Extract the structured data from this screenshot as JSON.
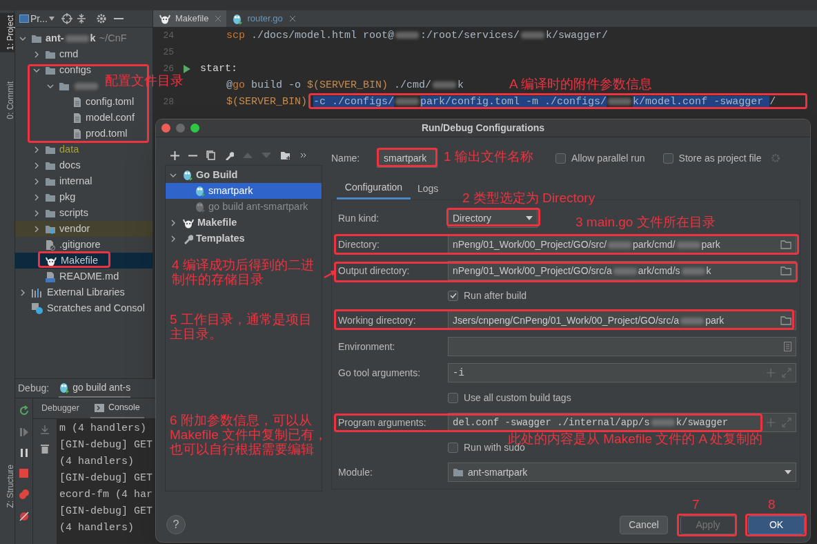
{
  "side_tool_tabs": [
    {
      "label": "1: Project",
      "selected": true
    },
    {
      "label": "0: Commit",
      "selected": false
    },
    {
      "label": "Z: Structure",
      "selected": false
    }
  ],
  "project_panel": {
    "title": "Pr...",
    "tree": [
      {
        "kind": "folder",
        "parts": [
          "ant-",
          "k"
        ],
        "hint": "~/CnF",
        "expanded": true,
        "children": [
          {
            "kind": "folder",
            "label": "cmd",
            "expanded": false
          },
          {
            "kind": "folder",
            "label": "configs",
            "expanded": true,
            "children": [
              {
                "kind": "folder",
                "redacted": true,
                "expanded": true,
                "children": [
                  {
                    "kind": "file",
                    "label": "config.toml"
                  },
                  {
                    "kind": "file",
                    "label": "model.conf"
                  },
                  {
                    "kind": "file",
                    "label": "prod.toml"
                  }
                ]
              }
            ]
          },
          {
            "kind": "folder",
            "label": "data",
            "expanded": false,
            "ignored": true
          },
          {
            "kind": "folder",
            "label": "docs",
            "expanded": false
          },
          {
            "kind": "folder",
            "label": "internal",
            "expanded": false
          },
          {
            "kind": "folder",
            "label": "pkg",
            "expanded": false
          },
          {
            "kind": "folder",
            "label": "scripts",
            "expanded": false
          },
          {
            "kind": "vendor",
            "label": "vendor",
            "expanded": false,
            "highlighted": true
          },
          {
            "kind": "gitignore",
            "label": ".gitignore"
          },
          {
            "kind": "makefile",
            "label": "Makefile",
            "selected": true
          },
          {
            "kind": "markdown",
            "label": "README.md"
          }
        ]
      },
      {
        "kind": "libraries",
        "label": "External Libraries",
        "expanded": false
      },
      {
        "kind": "scratches",
        "label": "Scratches and Consol"
      }
    ]
  },
  "editor": {
    "tabs": [
      {
        "label": "Makefile",
        "kind": "makefile",
        "selected": true
      },
      {
        "label": "router.go",
        "kind": "go",
        "selected": false
      }
    ],
    "lines": [
      {
        "number": "24",
        "tokens": [
          {
            "kind": "keyword",
            "text": "scp"
          },
          {
            "kind": "plain",
            "text": " ./docs/model.html root@"
          },
          {
            "kind": "redacted"
          },
          {
            "kind": "plain",
            "text": ":/root/services/"
          },
          {
            "kind": "redacted"
          },
          {
            "kind": "plain",
            "text": "k/swagger/"
          }
        ]
      },
      {
        "number": "25"
      },
      {
        "number": "26",
        "run": true,
        "tokens": [
          {
            "kind": "label",
            "text": "start:"
          }
        ]
      },
      {
        "tokens": [
          {
            "kind": "plain",
            "text": "@"
          },
          {
            "kind": "keyword",
            "text": "go"
          },
          {
            "kind": "plain",
            "text": " build -o "
          },
          {
            "kind": "variable",
            "text": "$(SERVER_BIN)"
          },
          {
            "kind": "plain",
            "text": " ./cmd/"
          },
          {
            "kind": "redacted"
          },
          {
            "kind": "plain",
            "text": "k"
          }
        ]
      },
      {
        "number": "28",
        "tokens": [
          {
            "kind": "variable",
            "text": "$(SERVER_BIN)"
          },
          {
            "kind": "selection",
            "text": "-c ./configs/"
          },
          {
            "kind": "redacted"
          },
          {
            "kind": "selection",
            "text": "park/config.toml -m ./configs/"
          },
          {
            "kind": "redacted"
          },
          {
            "kind": "selection",
            "text": "k/model.conf -swagger "
          },
          {
            "kind": "plain",
            "text": "/"
          }
        ]
      }
    ]
  },
  "debug_panel": {
    "label": "Debug:",
    "session_tab": "go build ant-s",
    "tabs": [
      {
        "label": "Debugger",
        "selected": false
      },
      {
        "label": "Console",
        "selected": true
      }
    ],
    "console_lines": [
      "m (4 handlers)",
      "[GIN-debug] GET",
      "(4 handlers)",
      "[GIN-debug] GET",
      "ecord-fm (4 har",
      "[GIN-debug] GET",
      "(4 handlers)"
    ]
  },
  "dialog": {
    "title": "Run/Debug Configurations",
    "tree": [
      {
        "kind": "go",
        "label": "Go Build",
        "expanded": true,
        "children": [
          {
            "kind": "go",
            "label": "smartpark",
            "selected": true
          },
          {
            "kind": "go",
            "label": "go build ant-smartpark",
            "selected": false,
            "temporary": true
          }
        ]
      },
      {
        "kind": "makefile",
        "label": "Makefile",
        "expanded": false
      },
      {
        "kind": "wrench",
        "label": "Templates",
        "expanded": false
      }
    ],
    "name_label": "Name:",
    "name_value": "smartpark",
    "options": [
      {
        "label": "Allow parallel run",
        "checked": false
      },
      {
        "label": "Store as project file",
        "checked": false
      }
    ],
    "tabs": [
      {
        "label": "Configuration",
        "selected": true
      },
      {
        "label": "Logs",
        "selected": false
      }
    ],
    "fields": [
      {
        "kind": "dropdown",
        "label": "Run kind:",
        "value": "Directory"
      },
      {
        "kind": "path",
        "label": "Directory:",
        "parts": [
          "nPeng/01_Work/00_Project/GO/src/",
          "park/cmd/",
          "park"
        ]
      },
      {
        "kind": "path",
        "label": "Output directory:",
        "parts": [
          "nPeng/01_Work/00_Project/GO/src/a",
          "ark/cmd/s",
          "k"
        ]
      },
      {
        "kind": "checkbox",
        "label": "Run after build",
        "checked": true
      },
      {
        "kind": "path",
        "label": "Working directory:",
        "parts": [
          "Jsers/cnpeng/CnPeng/01_Work/00_Project/GO/src/a",
          "park"
        ]
      },
      {
        "kind": "environment",
        "label": "Environment:"
      },
      {
        "kind": "expandable",
        "label": "Go tool arguments:",
        "parts": [
          "-i"
        ]
      },
      {
        "kind": "checkbox",
        "label": "Use all custom build tags",
        "checked": false
      },
      {
        "kind": "expandable",
        "label": "Program arguments:",
        "parts": [
          "del.conf -swagger ./internal/app/s",
          "k/swagger"
        ]
      },
      {
        "kind": "checkbox",
        "label": "Run with sudo",
        "checked": false
      },
      {
        "kind": "module",
        "label": "Module:",
        "value": "ant-smartpark"
      }
    ],
    "help": "?",
    "buttons": [
      {
        "label": "Cancel",
        "kind": "normal"
      },
      {
        "label": "Apply",
        "kind": "disabled"
      },
      {
        "label": "OK",
        "kind": "default"
      }
    ]
  },
  "annotations": [
    "配置文件目录",
    "A 编译时的附件参数信息",
    "1 输出文件名称",
    "2 类型选定为 Directory",
    "3 main.go 文件所在目录",
    "4 编译成功后得到的二进制件的存储目录",
    "5 工作目录，通常是项目主目录。",
    "6 附加参数信息，可以从Makefile 文件中复制已有，也可以自行根据需要编辑",
    "此处的内容是从 Makefile 文件的 A 处复制的",
    "7",
    "8"
  ]
}
